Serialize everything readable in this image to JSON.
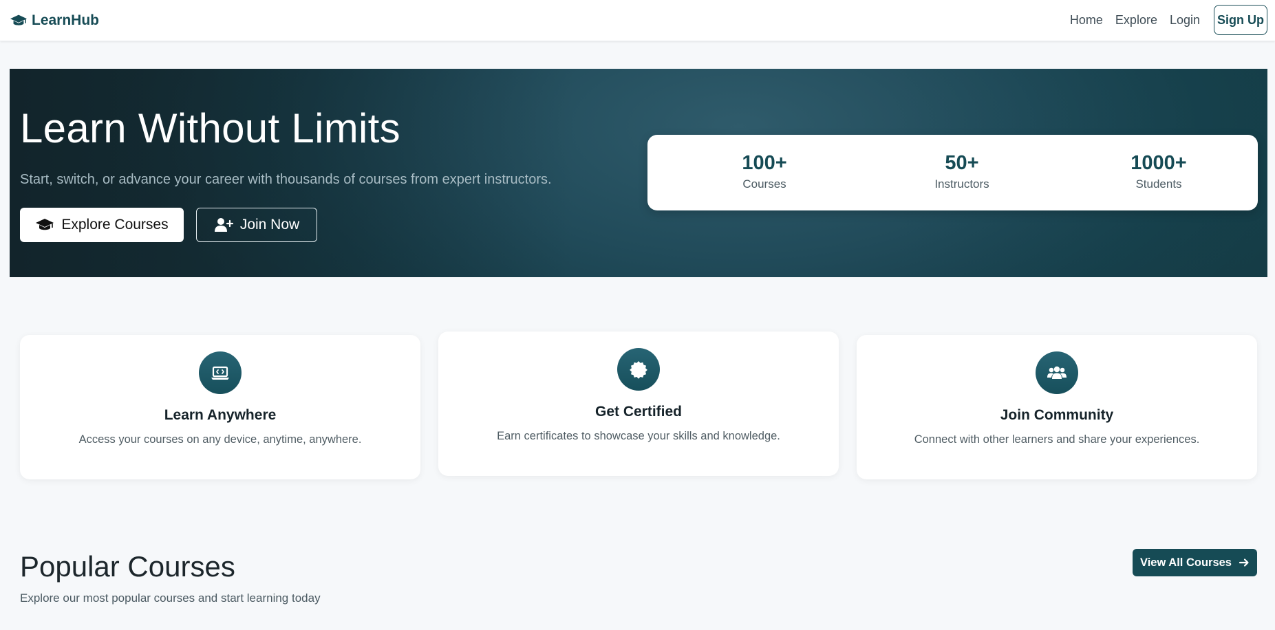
{
  "nav": {
    "brand": "LearnHub",
    "brand_icon": "graduation-cap-icon",
    "links": [
      "Home",
      "Explore",
      "Login"
    ],
    "signup": "Sign Up"
  },
  "hero": {
    "title": "Learn Without Limits",
    "subtitle": "Start, switch, or advance your career with thousands of courses from expert instructors.",
    "explore_button": "Explore Courses",
    "join_button": "Join Now",
    "stats": [
      {
        "value": "100+",
        "label": "Courses"
      },
      {
        "value": "50+",
        "label": "Instructors"
      },
      {
        "value": "1000+",
        "label": "Students"
      }
    ]
  },
  "features": [
    {
      "icon": "laptop-code-icon",
      "title": "Learn Anywhere",
      "description": "Access your courses on any device, anytime, anywhere."
    },
    {
      "icon": "certificate-icon",
      "title": "Get Certified",
      "description": "Earn certificates to showcase your skills and knowledge."
    },
    {
      "icon": "users-icon",
      "title": "Join Community",
      "description": "Connect with other learners and share your experiences."
    }
  ],
  "popular": {
    "title": "Popular Courses",
    "subtitle": "Explore our most popular courses and start learning today",
    "view_all": "View All Courses"
  },
  "colors": {
    "primary": "#164b55",
    "hero_dark": "#14222a",
    "page_bg": "#f6f8fa"
  }
}
